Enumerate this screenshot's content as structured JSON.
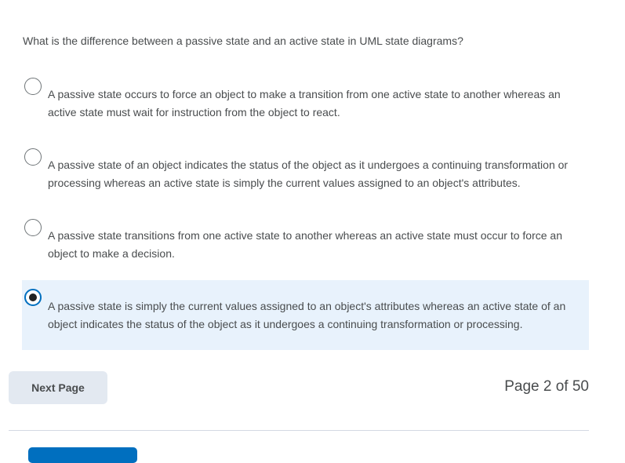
{
  "question": {
    "text": "What is the difference between a passive state and an active state in UML state diagrams?"
  },
  "options": [
    {
      "line1": "A passive state occurs to force an object to make a transition from one active state to another whereas an",
      "line2": "active state must wait for instruction from the object to react.",
      "selected": false
    },
    {
      "line1": "A passive state of an object indicates the status of the object as it undergoes a continuing transformation or",
      "line2": "processing whereas an active state is simply the current values assigned to an object's attributes.",
      "selected": false
    },
    {
      "line1": "A passive state transitions from one active state to another whereas an active state must occur to force an",
      "line2": "object to make a decision.",
      "selected": false
    },
    {
      "line1": "A passive state is simply the current values assigned to an object's attributes whereas an active state of an",
      "line2": "object indicates the status of the object as it undergoes a continuing transformation or processing.",
      "selected": true
    }
  ],
  "navigation": {
    "next_label": "Next Page",
    "page_text": "Page 2 of 50"
  },
  "colors": {
    "selected_background": "#e8f2fc",
    "accent": "#006fbf",
    "button_background": "#e3e9f1",
    "text": "#494c4e"
  }
}
